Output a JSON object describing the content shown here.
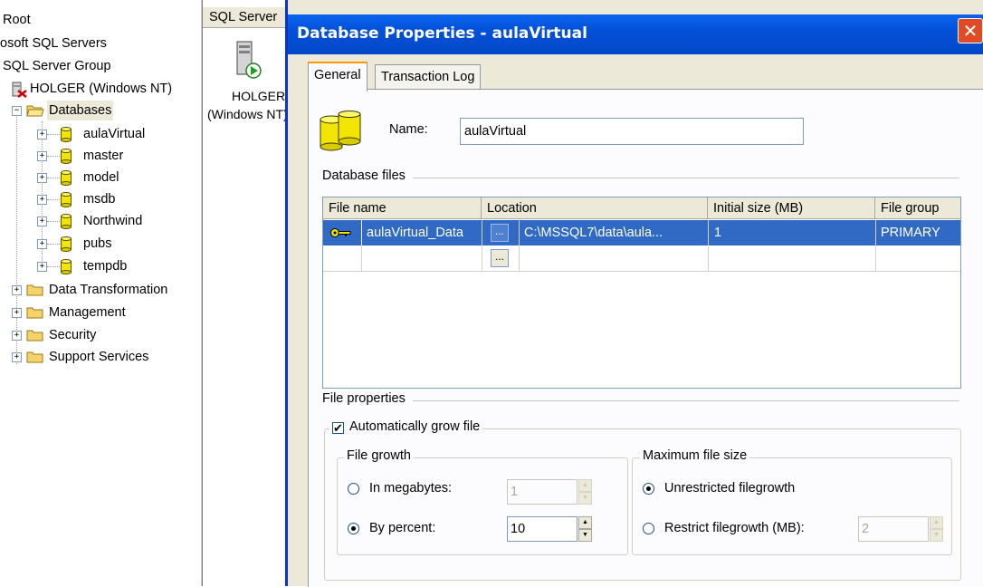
{
  "tree": {
    "root": "Root",
    "ms_sql_servers": "osoft SQL Servers",
    "server_group": "SQL Server Group",
    "server": "HOLGER (Windows NT)",
    "databases": "Databases",
    "dbs": [
      "aulaVirtual",
      "master",
      "model",
      "msdb",
      "Northwind",
      "pubs",
      "tempdb"
    ],
    "folders": [
      "Data Transformation",
      "Management",
      "Security",
      "Support Services"
    ]
  },
  "middle": {
    "header": "SQL Server",
    "server_label_1": "HOLGER",
    "server_label_2": "(Windows NT)"
  },
  "dialog": {
    "title": "Database Properties - aulaVirtual",
    "close_glyph": "✕",
    "tabs": [
      "General",
      "Transaction Log"
    ],
    "name_label": "Name:",
    "name_value": "aulaVirtual",
    "database_files_label": "Database files",
    "columns": [
      "File name",
      "Location",
      "Initial size (MB)",
      "File group"
    ],
    "rows": [
      {
        "file_name": "aulaVirtual_Data",
        "location": "C:\\MSSQL7\\data\\aula...",
        "initial_size": "1",
        "file_group": "PRIMARY"
      }
    ],
    "browse_glyph": "...",
    "file_properties_label": "File properties",
    "auto_grow_label": "Automatically grow file",
    "auto_grow_checked": true,
    "file_growth_legend": "File growth",
    "in_megabytes_label": "In megabytes:",
    "in_megabytes_value": "1",
    "by_percent_label": "By percent:",
    "by_percent_value": "10",
    "growth_mode": "percent",
    "max_size_legend": "Maximum file size",
    "unrestricted_label": "Unrestricted filegrowth",
    "restrict_label": "Restrict filegrowth (MB):",
    "restrict_value": "2",
    "max_mode": "unrestricted",
    "check_glyph": "✔",
    "spin_up_glyph": "▲",
    "spin_down_glyph": "▼"
  },
  "colors": {
    "titlebar": "#0450d8",
    "selection": "#316ac5",
    "dialog_bg": "#ece9d8",
    "close": "#e04a25"
  }
}
